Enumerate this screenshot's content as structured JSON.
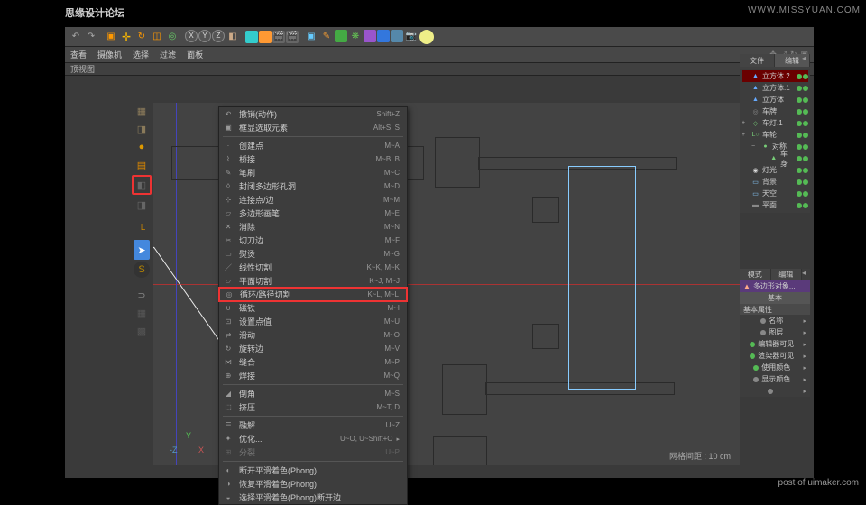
{
  "watermark_cn": "思缘设计论坛",
  "watermark_url": "WWW.MISSYUAN.COM",
  "post_credit": "post of uimaker.com",
  "menubar": [
    "查看",
    "摄像机",
    "选择",
    "过滤",
    "面板"
  ],
  "view_title": "顶视图",
  "status_grid": "网格间距 : 10 cm",
  "gizmo": {
    "x": "X",
    "y": "Y",
    "z": "-Z"
  },
  "ctx": [
    {
      "t": "item",
      "label": "撤销(动作)",
      "short": "Shift+Z",
      "ico": "↶"
    },
    {
      "t": "item",
      "label": "框显选取元素",
      "short": "Alt+S, S",
      "ico": "▣"
    },
    {
      "t": "sep"
    },
    {
      "t": "item",
      "label": "创建点",
      "short": "M~A",
      "ico": "·"
    },
    {
      "t": "item",
      "label": "桥接",
      "short": "M~B, B",
      "ico": "⌇"
    },
    {
      "t": "item",
      "label": "笔刷",
      "short": "M~C",
      "ico": "✎"
    },
    {
      "t": "item",
      "label": "封闭多边形孔洞",
      "short": "M~D",
      "ico": "◊"
    },
    {
      "t": "item",
      "label": "连接点/边",
      "short": "M~M",
      "ico": "⊹"
    },
    {
      "t": "item",
      "label": "多边形画笔",
      "short": "M~E",
      "ico": "▱"
    },
    {
      "t": "item",
      "label": "消除",
      "short": "M~N",
      "ico": "✕"
    },
    {
      "t": "item",
      "label": "切刀边",
      "short": "M~F",
      "ico": "✂"
    },
    {
      "t": "item",
      "label": "熨烫",
      "short": "M~G",
      "ico": "▭"
    },
    {
      "t": "item",
      "label": "线性切割",
      "short": "K~K, M~K",
      "ico": "／"
    },
    {
      "t": "item",
      "label": "平面切割",
      "short": "K~J, M~J",
      "ico": "▱"
    },
    {
      "t": "item",
      "label": "循环/路径切割",
      "short": "K~L, M~L",
      "ico": "◎",
      "hl": true
    },
    {
      "t": "item",
      "label": "磁铁",
      "short": "M~I",
      "ico": "∪"
    },
    {
      "t": "item",
      "label": "设置点值",
      "short": "M~U",
      "ico": "⊡"
    },
    {
      "t": "item",
      "label": "滑动",
      "short": "M~O",
      "ico": "⇄"
    },
    {
      "t": "item",
      "label": "旋转边",
      "short": "M~V",
      "ico": "↻"
    },
    {
      "t": "item",
      "label": "缝合",
      "short": "M~P",
      "ico": "⋈"
    },
    {
      "t": "item",
      "label": "焊接",
      "short": "M~Q",
      "ico": "⊕"
    },
    {
      "t": "sep"
    },
    {
      "t": "item",
      "label": "倒角",
      "short": "M~S",
      "ico": "◢"
    },
    {
      "t": "item",
      "label": "挤压",
      "short": "M~T, D",
      "ico": "⬚"
    },
    {
      "t": "sep"
    },
    {
      "t": "item",
      "label": "融解",
      "short": "U~Z",
      "ico": "☰"
    },
    {
      "t": "item",
      "label": "优化...",
      "short": "U~O, U~Shift+O",
      "ico": "✦",
      "arrow": true
    },
    {
      "t": "item",
      "label": "分裂",
      "short": "U~P",
      "ico": "⊞",
      "disabled": true
    },
    {
      "t": "sep"
    },
    {
      "t": "item",
      "label": "断开平滑着色(Phong)",
      "short": "",
      "ico": "◐"
    },
    {
      "t": "item",
      "label": "恢复平滑着色(Phong)",
      "short": "",
      "ico": "◑"
    },
    {
      "t": "item",
      "label": "选择平滑着色(Phong)断开边",
      "short": "",
      "ico": "◒"
    }
  ],
  "right_tabs1": [
    "文件",
    "编辑"
  ],
  "tree": [
    {
      "ico": "cube",
      "label": "立方体.2",
      "indent": 0,
      "exp": "",
      "hl": true
    },
    {
      "ico": "cube",
      "label": "立方体.1",
      "indent": 0
    },
    {
      "ico": "cube",
      "label": "立方体",
      "indent": 0
    },
    {
      "ico": "cam",
      "label": "车牌",
      "indent": 0
    },
    {
      "ico": "null",
      "label": "车灯.1",
      "indent": 0,
      "exp": "+"
    },
    {
      "ico": "null",
      "label": "车轮",
      "indent": 0,
      "exp": "+",
      "lo": true
    },
    {
      "ico": "null",
      "label": "对称",
      "indent": 1,
      "exp": "−",
      "sym": true
    },
    {
      "ico": "null",
      "label": "车身",
      "indent": 2,
      "cube2": true
    },
    {
      "ico": "light",
      "label": "灯光",
      "indent": 0
    },
    {
      "ico": "sky",
      "label": "背景",
      "indent": 0
    },
    {
      "ico": "sky",
      "label": "天空",
      "indent": 0
    },
    {
      "ico": "floor",
      "label": "平面",
      "indent": 0
    }
  ],
  "attr_tabs": [
    "模式",
    "编辑"
  ],
  "attr_title": "多边形对象...",
  "attr_btn": "基本",
  "attr_section": "基本属性",
  "attr_rows": [
    {
      "label": "名称",
      "val": ""
    },
    {
      "label": "图层",
      "val": ""
    },
    {
      "label": "编辑器可见",
      "dot": "dg"
    },
    {
      "label": "渲染器可见",
      "dot": "dg"
    },
    {
      "label": "使用颜色",
      "dot": "dg"
    },
    {
      "label": "显示颜色",
      "dot": "dgy"
    },
    {
      "label": "",
      "dot": ""
    }
  ]
}
